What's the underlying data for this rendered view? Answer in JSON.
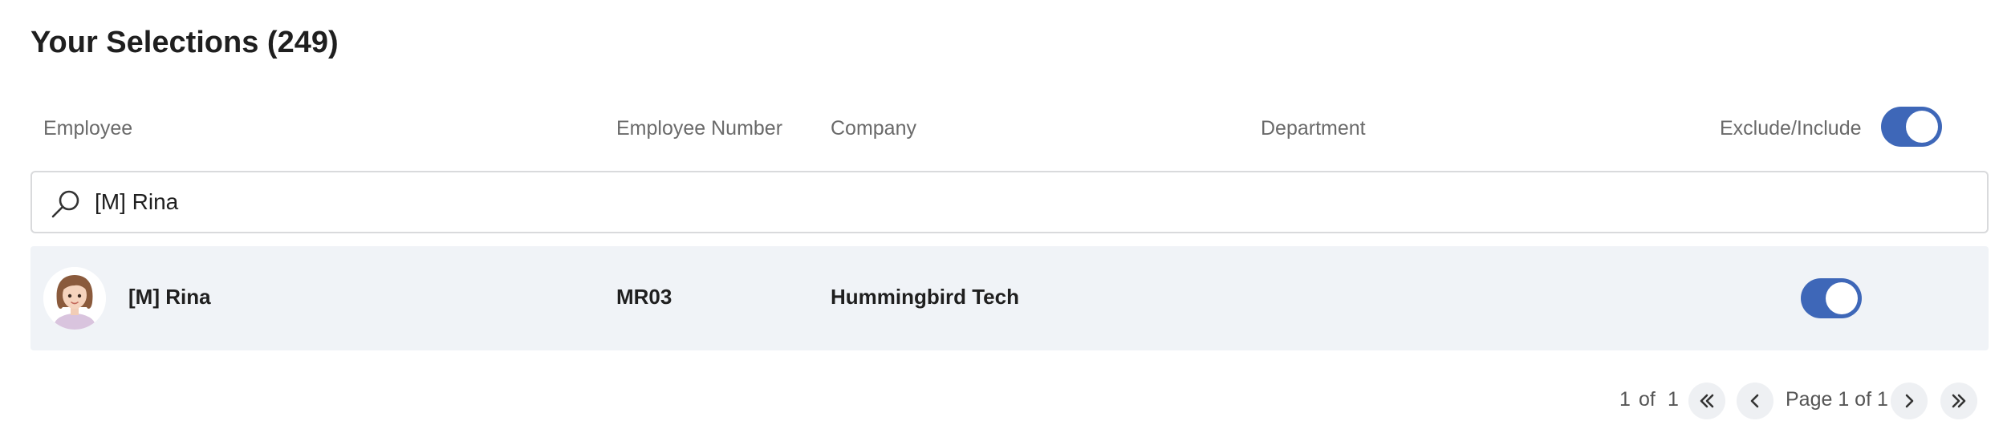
{
  "page": {
    "title": "Your Selections (249)"
  },
  "columns": {
    "employee": "Employee",
    "employee_number": "Employee Number",
    "company": "Company",
    "department": "Department",
    "exclude_include": "Exclude/Include"
  },
  "header_toggle": {
    "state": "on"
  },
  "search": {
    "value": "[M] Rina",
    "icon": "search-icon"
  },
  "rows": [
    {
      "name": "[M] Rina",
      "employee_number": "MR03",
      "company": "Hummingbird Tech",
      "department": "",
      "include": "on",
      "avatar": "avatar-icon"
    }
  ],
  "pagination": {
    "current": "1",
    "of_label": "of",
    "total": "1",
    "page_label": "Page 1 of 1",
    "icons": [
      "first-page-icon",
      "prev-page-icon",
      "next-page-icon",
      "last-page-icon"
    ]
  },
  "colors": {
    "accent": "#3e67b8",
    "row_bg": "#f0f3f7",
    "border": "#d9dadc"
  }
}
